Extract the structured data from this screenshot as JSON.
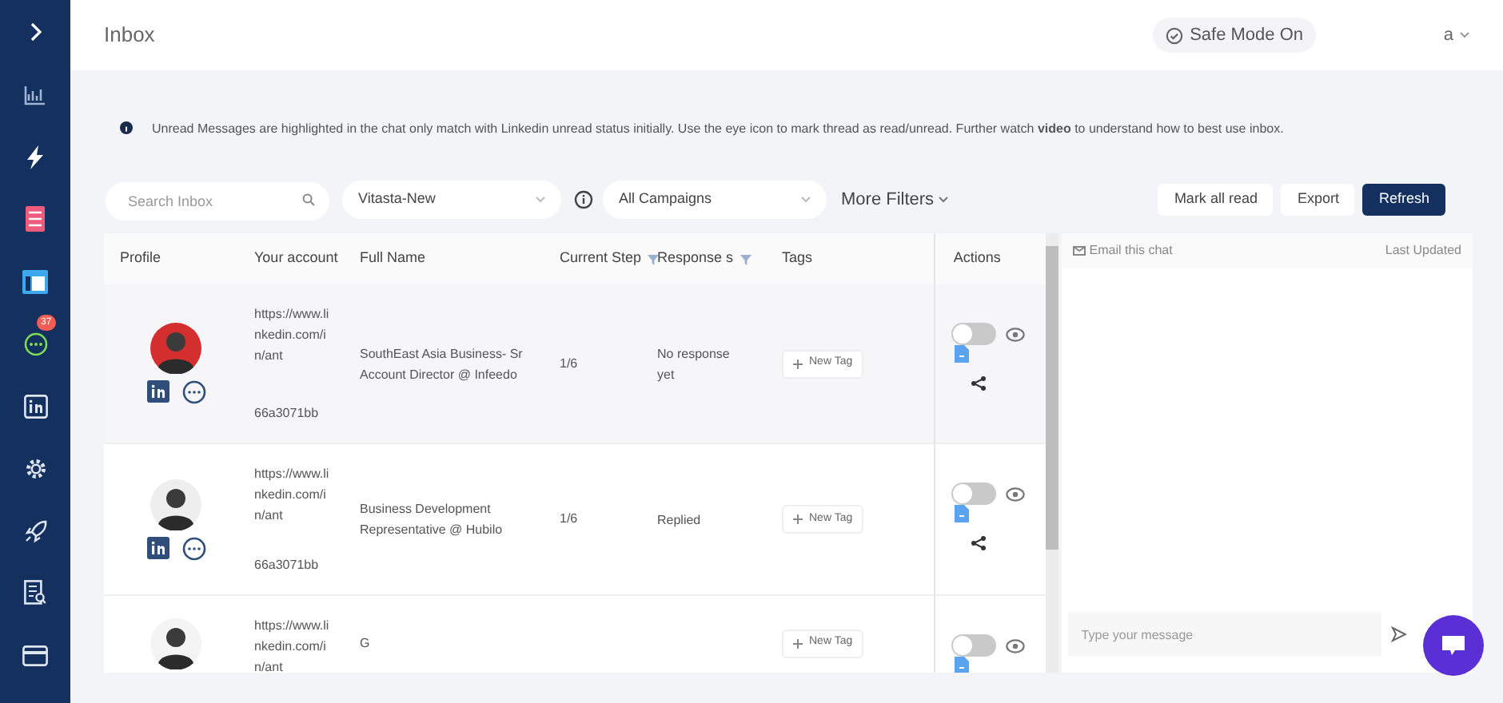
{
  "sidebar": {
    "chat_badge": "37"
  },
  "header": {
    "title": "Inbox",
    "safe_mode": "Safe Mode On",
    "user": "a"
  },
  "notice": "Unread Messages are highlighted in the chat only match with Linkedin unread status initially. Use the eye icon to mark thread as read/unread. Further watch **video** to understand how to best use inbox.",
  "filters": {
    "search": {
      "placeholder": "Search Inbox"
    },
    "account": "Vitasta-New",
    "campaign": "All Campaigns",
    "more": "More Filters"
  },
  "buttons": [
    {
      "label": "Mark all read",
      "primary": false
    },
    {
      "label": "Export",
      "primary": false
    },
    {
      "label": "Refresh",
      "primary": true
    }
  ],
  "table": {
    "columns": [
      {
        "label": "Profile",
        "filter": false
      },
      {
        "label": "Your account",
        "filter": false
      },
      {
        "label": "Full Name",
        "filter": false
      },
      {
        "label": "Current Step",
        "filter": true
      },
      {
        "label": "Response s",
        "filter": true
      },
      {
        "label": "Tags",
        "filter": false
      }
    ],
    "actions_label": "Actions",
    "rows": [
      {
        "account_url": "https://www.linkedin.com/in/ant",
        "account_id": "66a3071bb",
        "headline": "SouthEast Asia Business- Sr Account Director @ Infeedo",
        "step": "1/6",
        "response": "No response yet",
        "tag": "New Tag",
        "on": false
      },
      {
        "account_url": "https://www.linkedin.com/in/ant",
        "account_id": "66a3071bb",
        "headline": "Business Development Representative @ Hubilo",
        "step": "1/6",
        "response": "Replied",
        "tag": "New Tag",
        "on": false
      },
      {
        "account_url": "https://www.linkedin.com/in/ant",
        "headline": "G",
        "tag": "New Tag",
        "on": false
      }
    ]
  },
  "chat": {
    "email": "Email this chat",
    "last_updated": "Last Updated",
    "message": {
      "placeholder": "Type your message"
    }
  }
}
